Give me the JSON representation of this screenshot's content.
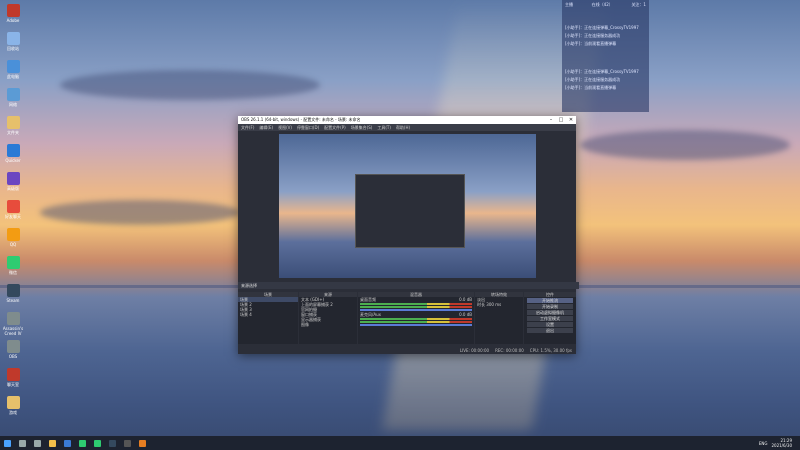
{
  "desktop": {
    "icons": [
      {
        "label": "Adobe",
        "color": "#c0392b"
      },
      {
        "label": "回收站",
        "color": "#8ab4e8"
      },
      {
        "label": "此电脑",
        "color": "#4a90d9"
      },
      {
        "label": "网络",
        "color": "#5b9bd5"
      },
      {
        "label": "文件夹",
        "color": "#e6c06b"
      },
      {
        "label": "Quicker",
        "color": "#2a7ad6"
      },
      {
        "label": "高级版",
        "color": "#6b46c1"
      },
      {
        "label": "好友聊天",
        "color": "#e74c3c"
      },
      {
        "label": "QQ",
        "color": "#f39c12"
      },
      {
        "label": "微信",
        "color": "#2ecc71"
      },
      {
        "label": "Steam",
        "color": "#34495e"
      },
      {
        "label": "Assassin's Creed IV",
        "color": "#7f8c8d"
      },
      {
        "label": "OBS",
        "color": "#7f8c8d"
      },
      {
        "label": "聊天室",
        "color": "#c0392b"
      },
      {
        "label": "游戏",
        "color": "#e6c06b"
      }
    ]
  },
  "overlay": {
    "top_left": "主播",
    "top_mid": "在线（42）",
    "top_right": "关注：1",
    "lines": [
      "[小助手]：正在连接弹幕_CrossyTV1997",
      "[小助手]：正在连接服务器成功",
      "[小助手]：当前观看直播弹幕",
      "[小助手]：正在连接弹幕_CrossyTV1997",
      "[小助手]：正在连接服务器成功",
      "[小助手]：当前观看直播弹幕"
    ]
  },
  "obs": {
    "title": "OBS 26.1.1 (64-bit, windows) - 配置文件: 未命名 - 场景: 未命名",
    "menu": [
      "文件(F)",
      "编辑(E)",
      "视图(V)",
      "停靠窗口(D)",
      "配置文件(P)",
      "场景集合(S)",
      "工具(T)",
      "帮助(H)"
    ],
    "preview_label": "来源选择",
    "scenes_title": "场景",
    "scenes": [
      "场景",
      "场景 2",
      "场景 3",
      "场景 4"
    ],
    "sources_title": "来源",
    "sources": [
      "文本 (GDI+)",
      "上面的屏幕捕获 2",
      "官网拍摄",
      "窗口捕获",
      "显示器捕获",
      "图像"
    ],
    "mixer_title": "混音器",
    "mixer": [
      {
        "name": "桌面音频",
        "db": "0.0 dB"
      },
      {
        "name": "麦克风/Aux",
        "db": "0.0 dB"
      }
    ],
    "transitions_title": "转场特效",
    "transition": "淡出",
    "duration_label": "时长",
    "duration": "300 ms",
    "controls_title": "控件",
    "controls": [
      "开始推流",
      "开始录制",
      "启动虚拟摄像机",
      "工作室模式",
      "设置",
      "退出"
    ],
    "status": {
      "live": "LIVE: 00:00:00",
      "rec": "REC: 00:00:00",
      "cpu": "CPU: 1.5%, 30.00 fps"
    }
  },
  "taskbar": {
    "time": "21:29",
    "date": "2021/6/30",
    "lang": "ENG"
  }
}
